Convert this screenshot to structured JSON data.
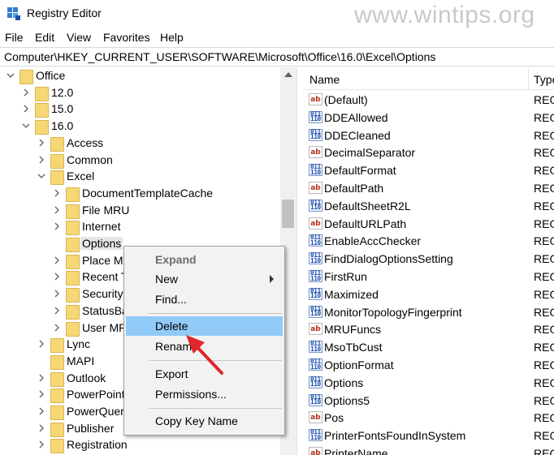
{
  "window": {
    "title": "Registry Editor",
    "watermark": "www.wintips.org"
  },
  "menu": [
    "File",
    "Edit",
    "View",
    "Favorites",
    "Help"
  ],
  "address": "Computer\\HKEY_CURRENT_USER\\SOFTWARE\\Microsoft\\Office\\16.0\\Excel\\Options",
  "tree": [
    {
      "label": "Office",
      "expanded": true
    },
    {
      "label": "12.0",
      "expanded": false
    },
    {
      "label": "15.0",
      "expanded": false
    },
    {
      "label": "16.0",
      "expanded": true
    },
    {
      "label": "Access",
      "expanded": false
    },
    {
      "label": "Common",
      "expanded": false
    },
    {
      "label": "Excel",
      "expanded": true
    },
    {
      "label": "DocumentTemplateCache",
      "expanded": false
    },
    {
      "label": "File MRU",
      "expanded": false
    },
    {
      "label": "Internet",
      "expanded": false
    },
    {
      "label": "Options",
      "selected": true
    },
    {
      "label": "Place M",
      "expanded": false
    },
    {
      "label": "Recent T",
      "expanded": false
    },
    {
      "label": "Security",
      "expanded": false
    },
    {
      "label": "StatusBa",
      "expanded": false
    },
    {
      "label": "User MR",
      "expanded": false
    },
    {
      "label": "Lync",
      "expanded": false
    },
    {
      "label": "MAPI",
      "expanded": false
    },
    {
      "label": "Outlook",
      "expanded": false
    },
    {
      "label": "PowerPoint",
      "expanded": false
    },
    {
      "label": "PowerQuer",
      "expanded": false
    },
    {
      "label": "Publisher",
      "expanded": false
    },
    {
      "label": "Registration",
      "expanded": false
    }
  ],
  "list": {
    "col_name": "Name",
    "col_type": "Type",
    "rows": [
      {
        "name": "(Default)",
        "type": "REG",
        "kind": "ab"
      },
      {
        "name": "DDEAllowed",
        "type": "REG",
        "kind": "bin"
      },
      {
        "name": "DDECleaned",
        "type": "REG",
        "kind": "bin"
      },
      {
        "name": "DecimalSeparator",
        "type": "REG",
        "kind": "ab"
      },
      {
        "name": "DefaultFormat",
        "type": "REG",
        "kind": "bin"
      },
      {
        "name": "DefaultPath",
        "type": "REG",
        "kind": "ab"
      },
      {
        "name": "DefaultSheetR2L",
        "type": "REG",
        "kind": "bin"
      },
      {
        "name": "DefaultURLPath",
        "type": "REG",
        "kind": "ab"
      },
      {
        "name": "EnableAccChecker",
        "type": "REG",
        "kind": "bin"
      },
      {
        "name": "FindDialogOptionsSetting",
        "type": "REG",
        "kind": "bin"
      },
      {
        "name": "FirstRun",
        "type": "REG",
        "kind": "bin"
      },
      {
        "name": "Maximized",
        "type": "REG",
        "kind": "bin"
      },
      {
        "name": "MonitorTopologyFingerprint",
        "type": "REG",
        "kind": "bin"
      },
      {
        "name": "MRUFuncs",
        "type": "REG",
        "kind": "ab"
      },
      {
        "name": "MsoTbCust",
        "type": "REG",
        "kind": "bin"
      },
      {
        "name": "OptionFormat",
        "type": "REG",
        "kind": "bin"
      },
      {
        "name": "Options",
        "type": "REG",
        "kind": "bin"
      },
      {
        "name": "Options5",
        "type": "REG",
        "kind": "bin"
      },
      {
        "name": "Pos",
        "type": "REG",
        "kind": "ab"
      },
      {
        "name": "PrinterFontsFoundInSystem",
        "type": "REG",
        "kind": "bin"
      },
      {
        "name": "PrinterName",
        "type": "REG",
        "kind": "ab"
      }
    ]
  },
  "context_menu": {
    "items": [
      {
        "label": "Expand",
        "disabled": true
      },
      {
        "label": "New",
        "submenu": true
      },
      {
        "label": "Find..."
      },
      {
        "label": "Delete",
        "highlight": true
      },
      {
        "label": "Rename"
      },
      {
        "label": "Export"
      },
      {
        "label": "Permissions..."
      },
      {
        "label": "Copy Key Name"
      }
    ]
  },
  "colors": {
    "highlight": "#91c9f7",
    "folder": "#f6d775",
    "arrow": "#e0252b"
  }
}
